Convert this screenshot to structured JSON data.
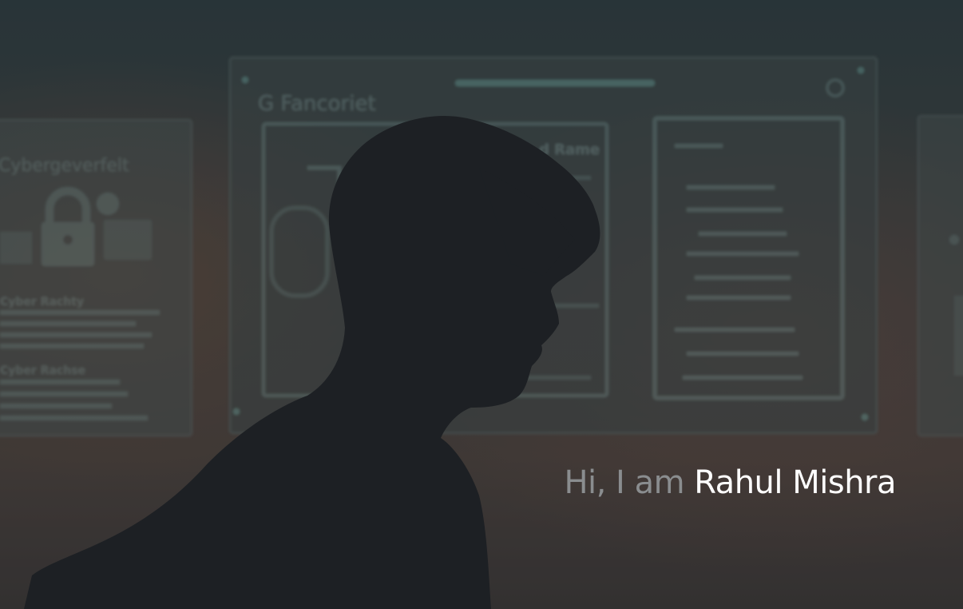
{
  "hero": {
    "greeting_prefix": "Hi, I am",
    "name": "Rahul Mishra",
    "background_description_icon": "person-silhouette-icon",
    "screen_texts": {
      "center_title": "G Fancoriet",
      "left_title": "Cybergeverfelt",
      "left_heading_1": "Cyber Rachty",
      "left_heading_2": "Cyber Rachse",
      "center_sub": "d Rame"
    }
  },
  "colors": {
    "overlay": "#2b3033",
    "greeting_muted": "#8a8d8f",
    "name": "#ffffff",
    "screen_glow": "#5a8a85",
    "warm_glow": "#8a5a45"
  }
}
